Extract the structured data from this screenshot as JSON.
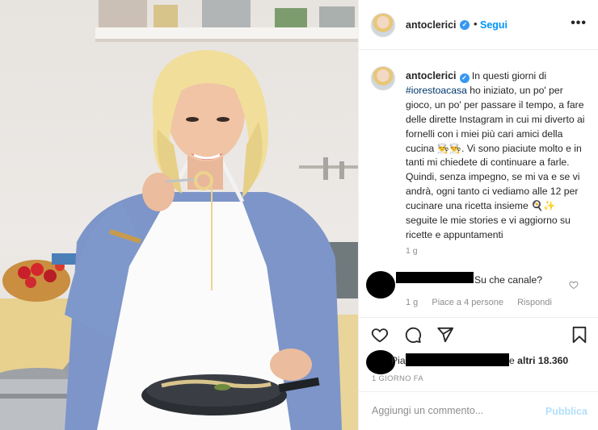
{
  "post": {
    "username": "antoclerici",
    "follow_label": "Segui",
    "more_icon": "•••",
    "verified_icon": "✓",
    "dot_separator": "•",
    "caption_text": [
      "In questi giorni di",
      "#iorestoacasa",
      " ho iniziato, un po' per gioco, un po' per passare il tempo, a fare delle dirette Instagram in cui mi diverto ai fornelli con i miei più cari amici della cucina 👨‍🍳👨‍🍳. Vi sono piaciute molto e in tanti mi chiedete di continuare a farle.\nQuindi, senza impegno, se mi va e se vi andrà, ogni tanto ci vediamo alle 12 per cucinare una ricetta insieme 🍳✨ seguite le mie stories e vi aggiorno su ricette e appuntamenti"
    ],
    "caption_time": "1 g"
  },
  "comment": {
    "text": "Su che canale?",
    "time": "1 g",
    "likes": "Piace a 4 persone",
    "reply_label": "Rispondi"
  },
  "likes": {
    "prefix": "Pia",
    "connector": "e",
    "others": "altri 18.360"
  },
  "date": "1 GIORNO FA",
  "comment_box": {
    "placeholder": "Aggiungi un commento...",
    "publish_label": "Pubblica"
  },
  "colors": {
    "link_blue": "#0095f6",
    "hashtag": "#00376b",
    "muted": "#8e8e8e",
    "publish_disabled": "#b2dffc"
  },
  "icons": [
    "heart-icon",
    "comment-icon",
    "share-icon",
    "bookmark-icon",
    "verified-icon",
    "more-icon"
  ]
}
